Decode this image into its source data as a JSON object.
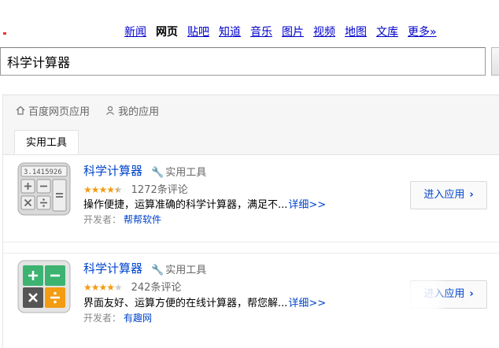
{
  "nav": {
    "items": [
      {
        "label": "新闻",
        "active": false
      },
      {
        "label": "网页",
        "active": true
      },
      {
        "label": "贴吧",
        "active": false
      },
      {
        "label": "知道",
        "active": false
      },
      {
        "label": "音乐",
        "active": false
      },
      {
        "label": "图片",
        "active": false
      },
      {
        "label": "视频",
        "active": false
      },
      {
        "label": "地图",
        "active": false
      },
      {
        "label": "文库",
        "active": false
      },
      {
        "label": "更多»",
        "active": false
      }
    ]
  },
  "search": {
    "value": "科学计算器"
  },
  "breadcrumb": {
    "home_label": "百度网页应用",
    "mine_label": "我的应用",
    "home_icon": "home-icon",
    "user_icon": "user-icon"
  },
  "tabs": [
    {
      "label": "实用工具",
      "active": true
    }
  ],
  "apps": [
    {
      "title": "科学计算器",
      "category": "实用工具",
      "rating_stars": 4.5,
      "review_count": "1272条评论",
      "description": "操作便捷，运算准确的科学计算器，满足不...",
      "more_label": "详细>>",
      "developer_label": "开发者：",
      "developer_name": "帮帮软件",
      "button_label": "进入应用",
      "icon": "calculator-gray-icon",
      "icon_display": "3.1415926"
    },
    {
      "title": "科学计算器",
      "category": "实用工具",
      "rating_stars": 4,
      "review_count": "242条评论",
      "description": "界面友好、运算方便的在线计算器，帮您解...",
      "more_label": "详细>>",
      "developer_label": "开发者：",
      "developer_name": "有趣网",
      "button_label": "进入应用",
      "icon": "calculator-color-icon"
    }
  ],
  "colors": {
    "link": "#0044cc",
    "star": "#f39c12",
    "calc_green": "#3cb371",
    "calc_orange": "#f39c12",
    "calc_dark": "#555555"
  }
}
